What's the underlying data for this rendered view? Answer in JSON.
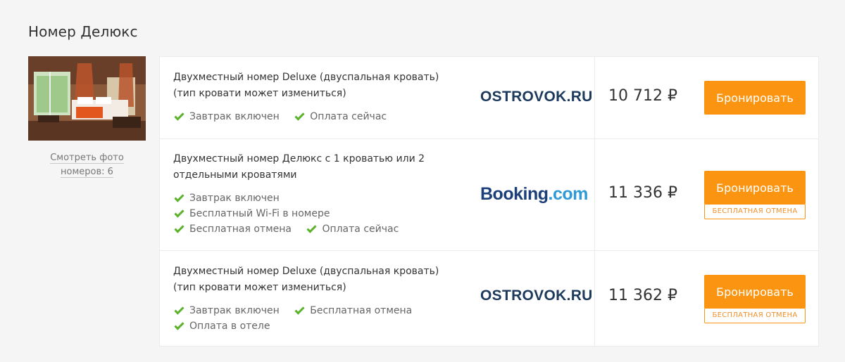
{
  "page": {
    "title": "Номер Делюкс"
  },
  "gallery": {
    "link_line1": "Смотреть фото",
    "link_line2": "номеров: 6"
  },
  "colors": {
    "button": "#fb9511",
    "check": "#5cb22b",
    "ostrovok_brand": "#1d3a5c",
    "booking_dark": "#1b3f7a",
    "booking_light": "#2f9ad5"
  },
  "offers": [
    {
      "room_line1": "Двухместный номер Deluxe (двуспальная кровать)",
      "room_line2": "(тип кровати может измениться)",
      "features": {
        "l1a": "Завтрак включен",
        "l1b": "Оплата сейчас"
      },
      "provider": "OSTROVOK.RU",
      "price": "10 712 ₽",
      "button_label": "Бронировать"
    },
    {
      "room_line1": "Двухместный номер Делюкс с 1 кроватью или 2",
      "room_line2": "отдельными кроватями",
      "features": {
        "l1a": "Завтрак включен",
        "l2a": "Бесплатный Wi-Fi в номере",
        "l3a": "Бесплатная отмена",
        "l3b": "Оплата сейчас"
      },
      "provider_part1": "Booking",
      "provider_part2": ".com",
      "price": "11 336 ₽",
      "button_label": "Бронировать",
      "badge": "БЕСПЛАТНАЯ ОТМЕНА"
    },
    {
      "room_line1": "Двухместный номер Deluxe (двуспальная кровать)",
      "room_line2": "(тип кровати может измениться)",
      "features": {
        "l1a": "Завтрак включен",
        "l1b": "Бесплатная отмена",
        "l2a": "Оплата в отеле"
      },
      "provider": "OSTROVOK.RU",
      "price": "11 362 ₽",
      "button_label": "Бронировать",
      "badge": "БЕСПЛАТНАЯ ОТМЕНА"
    }
  ]
}
